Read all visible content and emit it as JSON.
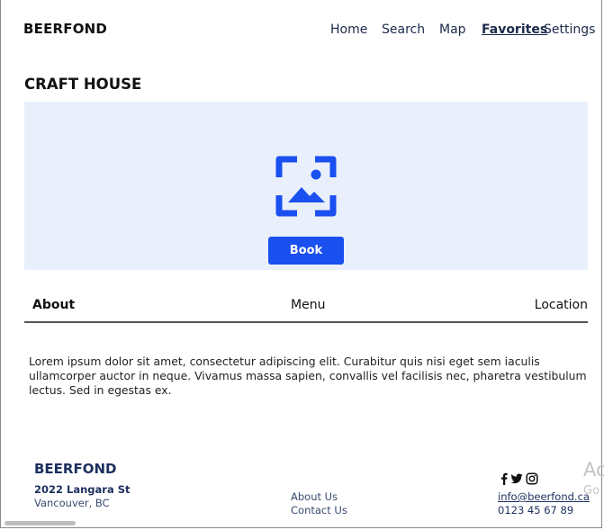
{
  "header": {
    "brand": "BEERFOND",
    "nav": [
      "Home",
      "Search",
      "Map",
      "Favorites",
      "Settings"
    ],
    "active_nav": "Favorites"
  },
  "page": {
    "title": "CRAFT HOUSE",
    "image_icon": "image-placeholder-icon",
    "book_label": "Book"
  },
  "tabs": [
    "About",
    "Menu",
    "Location"
  ],
  "active_tab": "About",
  "about_text": "Lorem ipsum dolor sit amet, consectetur adipiscing elit. Curabitur quis nisi eget sem iaculis ullamcorper auctor in neque. Vivamus massa sapien, convallis vel facilisis nec, pharetra vestibulum lectus. Sed in egestas ex.",
  "footer": {
    "brand": "BEERFOND",
    "address_line1": "2022 Langara St",
    "address_line2": "Vancouver, BC",
    "links": [
      "About Us",
      "Contact Us"
    ],
    "social_icons": [
      "facebook-icon",
      "twitter-icon",
      "instagram-icon"
    ],
    "email": "info@beerfond.ca",
    "phone": "0123 45 67 89"
  },
  "watermark": {
    "line1": "Ac",
    "line2": "Go"
  },
  "colors": {
    "accent": "#1a4ff0",
    "hero_bg": "#e9f0fb",
    "footer_text": "#1c2f5e"
  }
}
